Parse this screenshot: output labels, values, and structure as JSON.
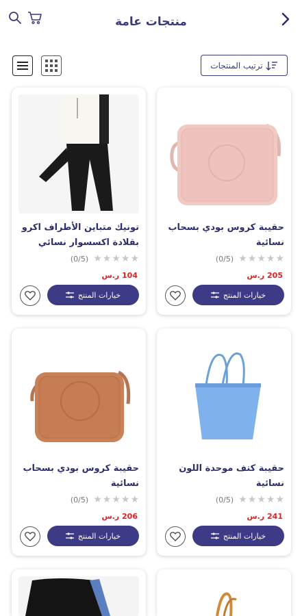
{
  "header": {
    "title": "منتجات عامة"
  },
  "toolbar": {
    "sort_label": "ترتيب المنتجات"
  },
  "products": [
    {
      "name": "حقيبة كروس بودي بسحاب نسائية",
      "rating_count": "(0/5)",
      "price": "205 ر.س",
      "options_label": "خيارات المنتج"
    },
    {
      "name": "تونيك متباين الأطراف اكرو بقلادة اكسسوار نسائي",
      "rating_count": "(0/5)",
      "price": "104 ر.س",
      "options_label": "خيارات المنتج"
    },
    {
      "name": "حقيبة كتف موحدة اللون نسائية",
      "rating_count": "(0/5)",
      "price": "241 ر.س",
      "options_label": "خيارات المنتج"
    },
    {
      "name": "حقيبة كروس بودي بسحاب نسائية",
      "rating_count": "(0/5)",
      "price": "206 ر.س",
      "options_label": "خيارات المنتج"
    }
  ],
  "colors": {
    "primary": "#3d3a86",
    "title": "#3b3a7a",
    "price": "#e02020",
    "star": "#c8c8c8"
  },
  "icons": [
    "back-chevron-icon",
    "search-icon",
    "cart-icon",
    "sort-icon",
    "grid-view-icon",
    "list-view-icon",
    "star-icon",
    "options-icon",
    "heart-icon"
  ]
}
